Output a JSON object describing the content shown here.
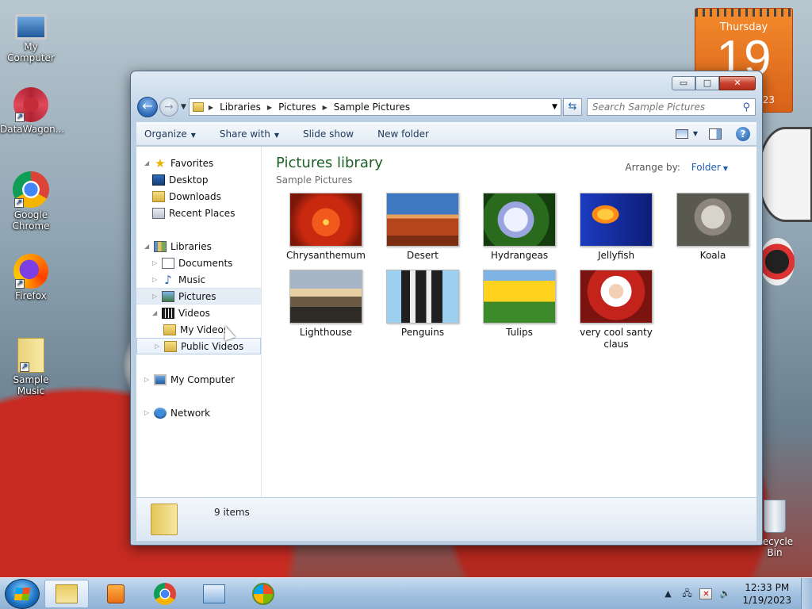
{
  "desktop": {
    "icons": [
      {
        "label": "My Computer",
        "icon": "computer-icon"
      },
      {
        "label": "DataWagon...",
        "icon": "datawagon-icon"
      },
      {
        "label": "Google Chrome",
        "icon": "chrome-icon"
      },
      {
        "label": "Firefox",
        "icon": "firefox-icon"
      },
      {
        "label": "Sample Music",
        "icon": "folder-icon"
      }
    ],
    "recycle_bin": "Recycle Bin",
    "calendar": {
      "weekday": "Thursday",
      "day": "19",
      "year_fragment": "23"
    }
  },
  "window": {
    "caption": {
      "minimize": "▭",
      "maximize": "□",
      "close": "✕"
    },
    "address": {
      "crumbs": [
        "Libraries",
        "Pictures",
        "Sample Pictures"
      ]
    },
    "search": {
      "placeholder": "Search Sample Pictures"
    },
    "toolbar": {
      "organize": "Organize",
      "share_with": "Share with",
      "slide_show": "Slide show",
      "new_folder": "New folder",
      "help": "?"
    },
    "navpane": {
      "favorites": "Favorites",
      "desktop": "Desktop",
      "downloads": "Downloads",
      "recent_places": "Recent Places",
      "libraries": "Libraries",
      "documents": "Documents",
      "music": "Music",
      "pictures": "Pictures",
      "videos": "Videos",
      "my_videos": "My Videos",
      "public_videos": "Public Videos",
      "my_computer": "My Computer",
      "network": "Network"
    },
    "content": {
      "title": "Pictures library",
      "subtitle": "Sample Pictures",
      "arrange_label": "Arrange by:",
      "arrange_value": "Folder",
      "items": [
        {
          "name": "Chrysanthemum"
        },
        {
          "name": "Desert"
        },
        {
          "name": "Hydrangeas"
        },
        {
          "name": "Jellyfish"
        },
        {
          "name": "Koala"
        },
        {
          "name": "Lighthouse"
        },
        {
          "name": "Penguins"
        },
        {
          "name": "Tulips"
        },
        {
          "name": "very cool santy claus"
        }
      ]
    },
    "status": {
      "count": "9 items"
    }
  },
  "taskbar": {
    "clock_time": "12:33 PM",
    "clock_date": "1/19/2023"
  }
}
